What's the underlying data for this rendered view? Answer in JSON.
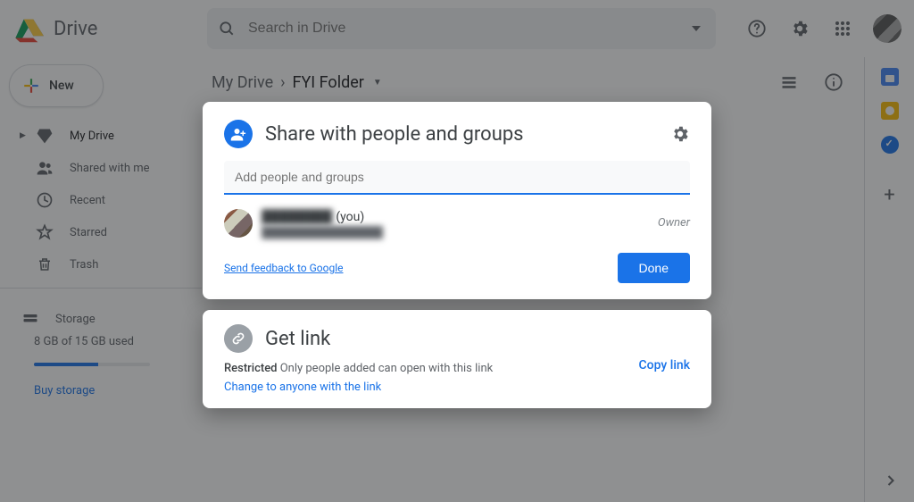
{
  "app": {
    "name": "Drive"
  },
  "search": {
    "placeholder": "Search in Drive"
  },
  "sidebar": {
    "new_label": "New",
    "items": [
      {
        "label": "My Drive"
      },
      {
        "label": "Shared with me"
      },
      {
        "label": "Recent"
      },
      {
        "label": "Starred"
      },
      {
        "label": "Trash"
      }
    ],
    "storage_label": "Storage",
    "storage_used": "8 GB of 15 GB used",
    "buy_label": "Buy storage"
  },
  "breadcrumb": {
    "root": "My Drive",
    "current": "FYI Folder"
  },
  "share_dialog": {
    "title": "Share with people and groups",
    "input_placeholder": "Add people and groups",
    "person_name": "████████",
    "you_suffix": "(you)",
    "person_email": "████████████████",
    "role": "Owner",
    "feedback": "Send feedback to Google",
    "done": "Done"
  },
  "getlink": {
    "title": "Get link",
    "mode": "Restricted",
    "desc": "Only people added can open with this link",
    "change": "Change to anyone with the link",
    "copy": "Copy link"
  }
}
